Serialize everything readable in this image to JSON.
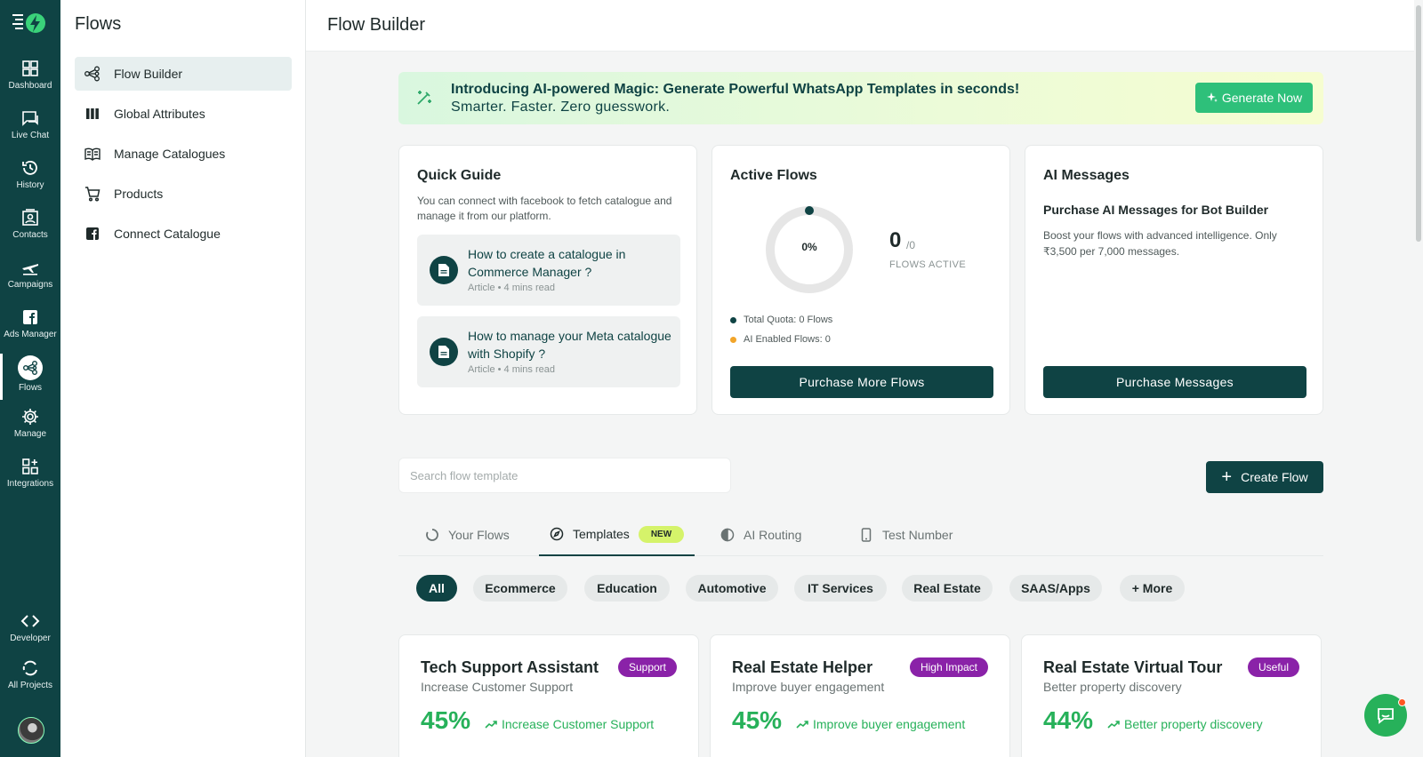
{
  "rail": {
    "items": [
      {
        "label": "Dashboard",
        "icon": "dashboard-icon"
      },
      {
        "label": "Live Chat",
        "icon": "chat-icon"
      },
      {
        "label": "History",
        "icon": "history-icon"
      },
      {
        "label": "Contacts",
        "icon": "contacts-icon"
      },
      {
        "label": "Campaigns",
        "icon": "campaigns-icon"
      },
      {
        "label": "Ads Manager",
        "icon": "facebook-icon"
      },
      {
        "label": "Flows",
        "icon": "flows-icon"
      },
      {
        "label": "Manage",
        "icon": "gear-icon"
      },
      {
        "label": "Integrations",
        "icon": "integrations-icon"
      }
    ],
    "bottom": [
      {
        "label": "Developer",
        "icon": "code-icon"
      },
      {
        "label": "All Projects",
        "icon": "projects-icon"
      }
    ]
  },
  "subnav": {
    "title": "Flows",
    "items": [
      {
        "label": "Flow Builder"
      },
      {
        "label": "Global Attributes"
      },
      {
        "label": "Manage Catalogues"
      },
      {
        "label": "Products"
      },
      {
        "label": "Connect Catalogue"
      }
    ]
  },
  "header": {
    "title": "Flow Builder"
  },
  "banner": {
    "title": "Introducing AI-powered Magic: Generate Powerful WhatsApp Templates in seconds!",
    "subtitle": "Smarter. Faster. Zero guesswork.",
    "button": "Generate Now"
  },
  "quick_guide": {
    "title": "Quick Guide",
    "description": "You can connect with facebook to fetch catalogue and manage it from our platform.",
    "articles": [
      {
        "title": "How to create a catalogue in Commerce Manager ?",
        "meta": "Article • 4 mins read"
      },
      {
        "title": "How to manage your Meta catalogue with Shopify ?",
        "meta": "Article • 4 mins read"
      }
    ]
  },
  "active_flows": {
    "title": "Active Flows",
    "percent_label": "0%",
    "percent_value": 0,
    "count": "0",
    "total": "/0",
    "count_label": "FLOWS ACTIVE",
    "legend": [
      {
        "label": "Total Quota: 0 Flows",
        "color": "#0f4344"
      },
      {
        "label": "AI Enabled Flows: 0",
        "color": "#f2a52a"
      }
    ],
    "button": "Purchase More Flows"
  },
  "ai_messages": {
    "title": "AI Messages",
    "heading": "Purchase AI Messages for Bot Builder",
    "description": "Boost your flows with advanced intelligence. Only ₹3,500 per 7,000 messages.",
    "button": "Purchase Messages"
  },
  "search": {
    "placeholder": "Search flow template"
  },
  "create_button": {
    "label": "Create Flow"
  },
  "tabs": [
    {
      "label": "Your Flows"
    },
    {
      "label": "Templates",
      "badge": "NEW"
    },
    {
      "label": "AI Routing"
    },
    {
      "label": "Test Number"
    }
  ],
  "chips": [
    {
      "label": "All"
    },
    {
      "label": "Ecommerce"
    },
    {
      "label": "Education"
    },
    {
      "label": "Automotive"
    },
    {
      "label": "IT Services"
    },
    {
      "label": "Real Estate"
    },
    {
      "label": "SAAS/Apps"
    },
    {
      "label": "+ More"
    }
  ],
  "templates": [
    {
      "title": "Tech Support Assistant",
      "tag": "Support",
      "subtitle": "Increase Customer Support",
      "percent": "45%",
      "trend": "Increase Customer Support"
    },
    {
      "title": "Real Estate Helper",
      "tag": "High Impact",
      "subtitle": "Improve buyer engagement",
      "percent": "45%",
      "trend": "Improve buyer engagement"
    },
    {
      "title": "Real Estate Virtual Tour",
      "tag": "Useful",
      "subtitle": "Better property discovery",
      "percent": "44%",
      "trend": "Better property discovery"
    }
  ],
  "colors": {
    "brand": "#0f4344",
    "accent": "#27b15a",
    "tag": "#8a22a8",
    "new_badge": "#d5f36a"
  }
}
